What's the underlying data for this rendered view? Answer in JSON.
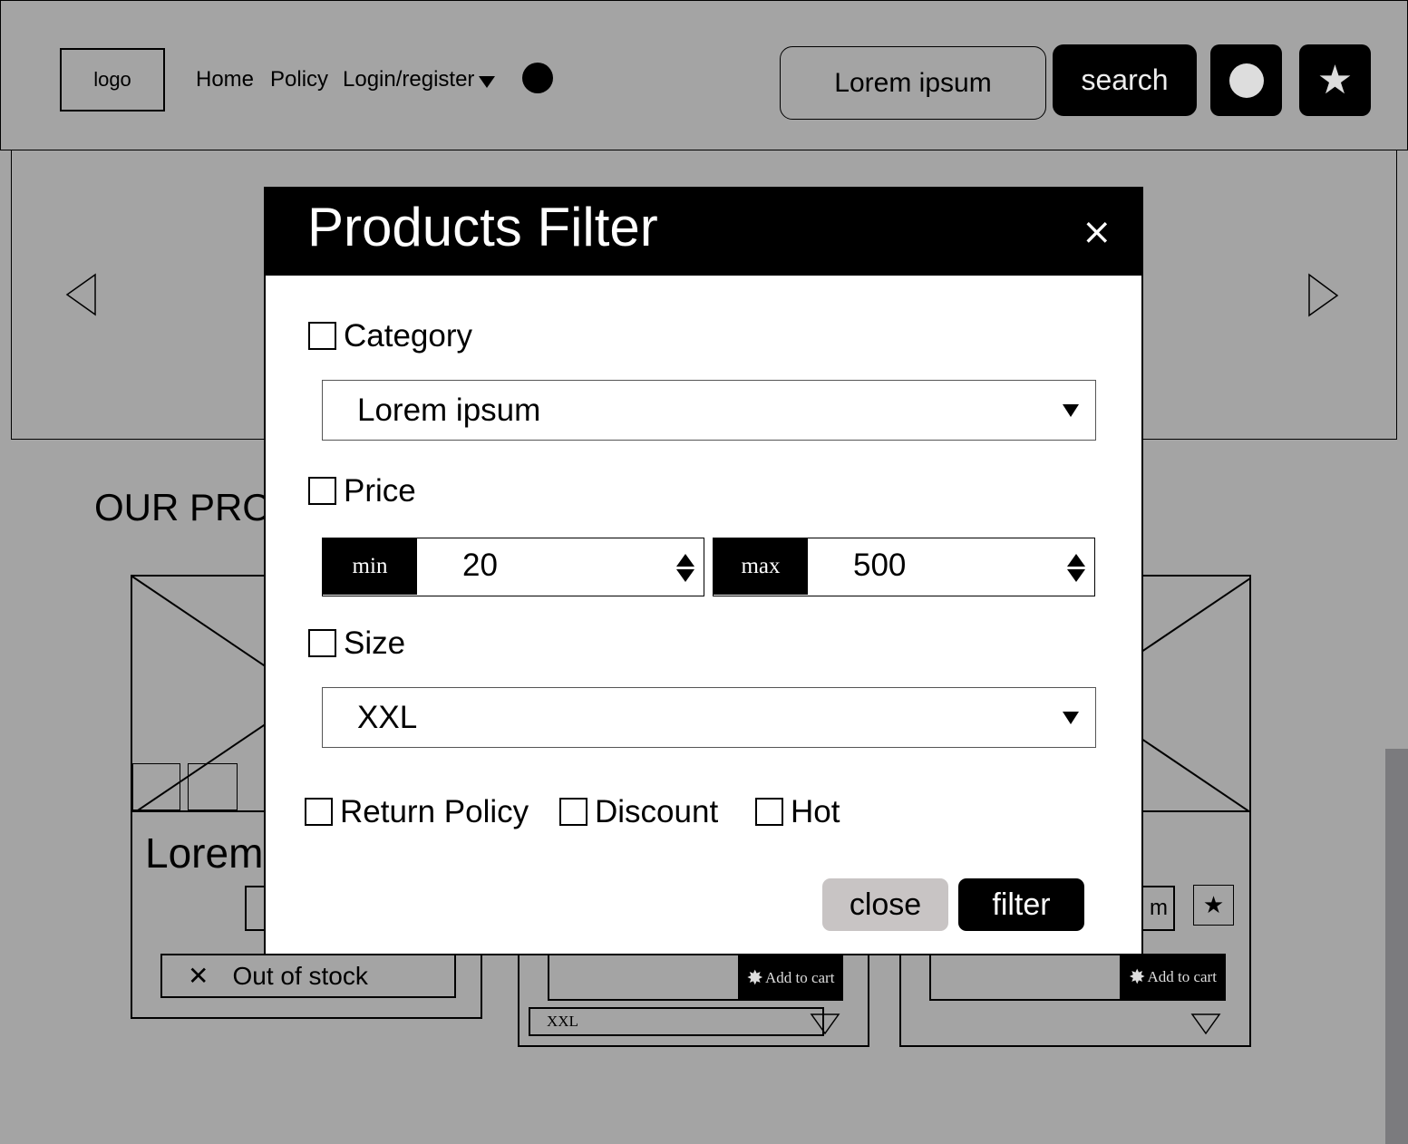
{
  "header": {
    "logo": "logo",
    "nav": {
      "home": "Home",
      "policy": "Policy",
      "login": "Login/register"
    },
    "search_value": "Lorem ipsum",
    "search_button": "search"
  },
  "page": {
    "section_title": "OUR PROD",
    "card1": {
      "title": "Lorem i",
      "out_of_stock": "Out of stock"
    },
    "card2": {
      "add_to_cart": "Add to cart",
      "size": "XXL"
    },
    "card3": {
      "partial_text": "m",
      "add_to_cart": "Add to cart"
    }
  },
  "modal": {
    "title": "Products Filter",
    "close_icon": "×",
    "category": {
      "label": "Category",
      "value": "Lorem ipsum",
      "checked": false
    },
    "price": {
      "label": "Price",
      "checked": false,
      "min_label": "min",
      "min_value": "20",
      "max_label": "max",
      "max_value": "500"
    },
    "size": {
      "label": "Size",
      "value": "XXL",
      "checked": false
    },
    "flags": [
      {
        "label": "Return Policy",
        "checked": false
      },
      {
        "label": "Discount",
        "checked": false
      },
      {
        "label": "Hot",
        "checked": false
      }
    ],
    "buttons": {
      "close": "close",
      "filter": "filter"
    }
  },
  "colors": {
    "background": "#a4a4a4",
    "primary": "#000000",
    "modal_bg": "#ffffff",
    "close_button": "#c8c4c4",
    "scrollbar": "#7b7b7e"
  }
}
